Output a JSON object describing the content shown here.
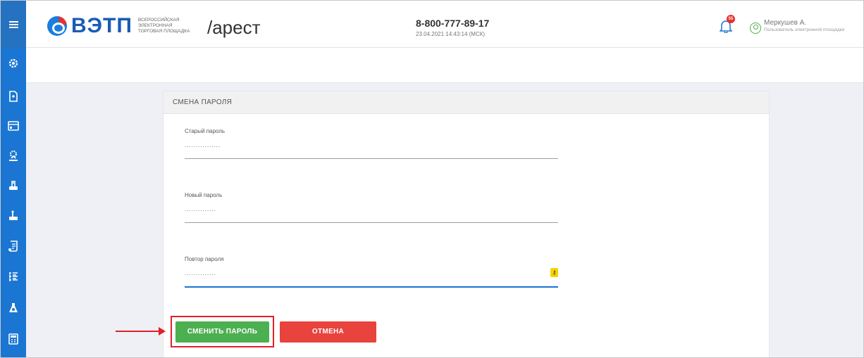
{
  "header": {
    "logo_text": "ВЭТП",
    "logo_sub": [
      "ВСЕРОССИЙСКАЯ",
      "ЭЛЕКТРОННАЯ",
      "ТОРГОВАЯ ПЛОЩАДКА"
    ],
    "section": "/арест",
    "phone": "8-800-777-89-17",
    "datetime": "23.04.2021 14:43:14 (МСК)",
    "notification_count": "55",
    "user_name": "Меркушев А.",
    "user_role": "Пользователь электронной площадки"
  },
  "sidebar": {
    "icons": [
      "menu-icon",
      "gear-icon",
      "document-icon",
      "card-icon",
      "person-gear-icon",
      "auction-icon",
      "auction-alt-icon",
      "scroll-icon",
      "list-icon",
      "flask-icon",
      "calculator-icon"
    ]
  },
  "panel": {
    "title": "СМЕНА ПАРОЛЯ",
    "fields": [
      {
        "label": "Старый пароль",
        "value": "················"
      },
      {
        "label": "Новый пароль",
        "value": "··············"
      },
      {
        "label": "Повтор пароля",
        "value": "··············"
      }
    ],
    "change_button": "СМЕНИТЬ ПАРОЛЬ",
    "cancel_button": "ОТМЕНА"
  },
  "colors": {
    "sidebar": "#1a76d2",
    "accent_green": "#4caf50",
    "accent_red": "#e8433c",
    "annotation_red": "#e0202a"
  }
}
